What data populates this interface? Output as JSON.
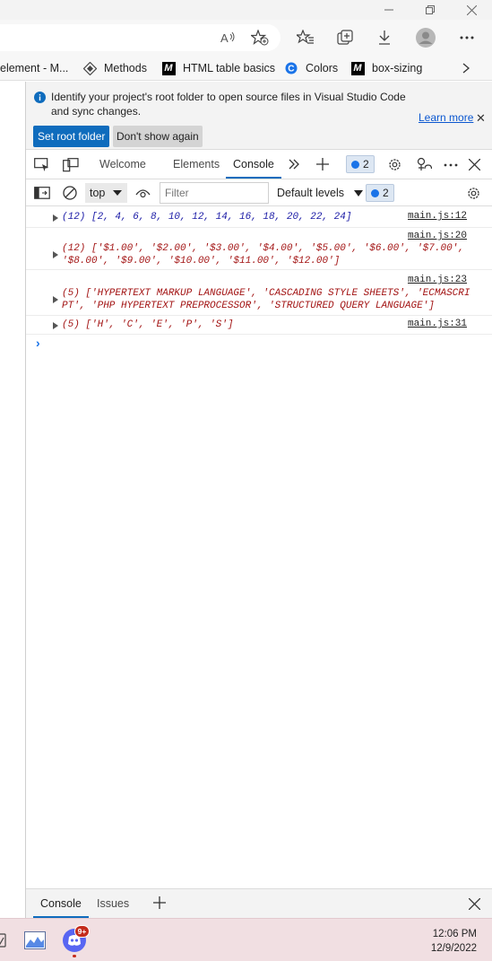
{
  "window": {
    "minimize_icon": "minimize-icon",
    "restore_icon": "restore-icon",
    "close_icon": "close-icon"
  },
  "toolbar": {
    "icons": [
      "read-aloud-icon",
      "add-favorite-icon",
      "favorites-icon",
      "collections-icon",
      "downloads-icon",
      "profile-icon",
      "more-icon"
    ]
  },
  "favorites": {
    "items": [
      {
        "label": "element - M...",
        "icon": "none"
      },
      {
        "label": "Methods",
        "icon": "diamond-icon"
      },
      {
        "label": "HTML table basics",
        "icon": "mdn-icon"
      },
      {
        "label": "Colors",
        "icon": "c-logo-icon"
      },
      {
        "label": "box-sizing",
        "icon": "mdn-icon"
      }
    ],
    "overflow_icon": "chevron-right-icon"
  },
  "infobar": {
    "message": "Identify your project's root folder to open source files in Visual Studio Code and sync changes.",
    "learn_more": "Learn more",
    "close_label": "✕",
    "set_root_label": "Set root folder",
    "dont_show_label": "Don't show again"
  },
  "devtools_tabs": {
    "items": [
      "Welcome",
      "Elements",
      "Console"
    ],
    "active": "Console",
    "issues_count": "2"
  },
  "console_toolbar": {
    "context": "top",
    "filter_placeholder": "Filter",
    "levels_label": "Default levels",
    "issues_count": "2"
  },
  "console": {
    "messages": [
      {
        "line1": "(12) [2, 4, 6, 8, 10, 12, 14, 16, 18, 20, 22, 24]",
        "source": "main.js:12"
      },
      {
        "line1": "(12) ['$1.00', '$2.00', '$3.00', '$4.00', '$5.00', '$6.00', '$7.00',",
        "line2": "'$8.00', '$9.00', '$10.00', '$11.00', '$12.00']",
        "source": "main.js:20"
      },
      {
        "line1": "(5) ['HYPERTEXT MARKUP LANGUAGE', 'CASCADING STYLE SHEETS', 'ECMASCRI",
        "line2": "PT', 'PHP HYPERTEXT PREPROCESSOR', 'STRUCTURED QUERY LANGUAGE']",
        "source": "main.js:23"
      },
      {
        "line1": "(5) ['H', 'C', 'E', 'P', 'S']",
        "source": "main.js:31"
      }
    ],
    "prompt": "›"
  },
  "drawer": {
    "tabs": [
      "Console",
      "Issues"
    ],
    "active": "Console"
  },
  "taskbar": {
    "time": "12:06 PM",
    "date": "12/9/2022",
    "notification_count": "9+"
  }
}
